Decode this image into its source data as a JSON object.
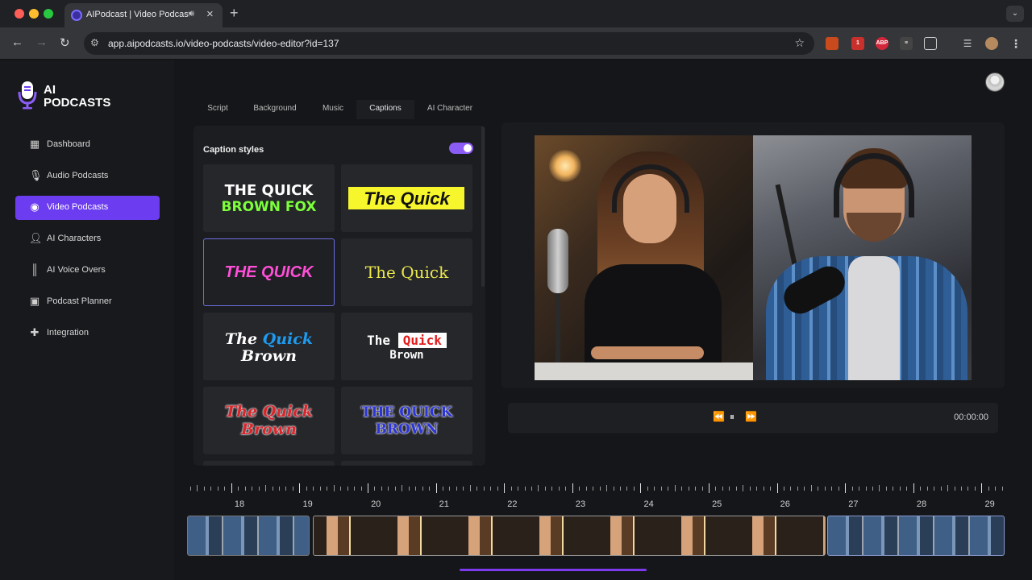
{
  "browser": {
    "tab_title": "AIPodcast | Video Podcasts",
    "audio_icon": "speaker-icon",
    "url": "app.aipodcasts.io/video-podcasts/video-editor?id=137",
    "new_tab": "+",
    "close": "×",
    "extension_abp": "ABP",
    "extension_badge": "1"
  },
  "sidebar": {
    "logo_line1": "AI",
    "logo_line2": "PODCASTS",
    "items": [
      {
        "label": "Dashboard",
        "icon": "grid-icon"
      },
      {
        "label": "Audio Podcasts",
        "icon": "microphone-icon"
      },
      {
        "label": "Video Podcasts",
        "icon": "podcast-icon",
        "active": true
      },
      {
        "label": "AI Characters",
        "icon": "user-icon"
      },
      {
        "label": "AI Voice Overs",
        "icon": "waveform-icon"
      },
      {
        "label": "Podcast Planner",
        "icon": "calendar-icon"
      },
      {
        "label": "Integration",
        "icon": "puzzle-icon"
      }
    ]
  },
  "editor": {
    "tabs": [
      "Script",
      "Background",
      "Music",
      "Captions",
      "AI Character"
    ],
    "active_tab": "Captions",
    "panel_title": "Caption styles",
    "toggle_on": true,
    "captions": [
      {
        "line1": "THE QUICK",
        "line2": "BROWN FOX"
      },
      {
        "line1": "The Quick"
      },
      {
        "line1": "THE QUICK",
        "selected": true
      },
      {
        "line1": "The Quick"
      },
      {
        "line1": "The",
        "line1b": "Quick",
        "line2": "Brown"
      },
      {
        "line1": "The",
        "line1b": "Quick",
        "line2": "Brown"
      },
      {
        "line1": "The Quick",
        "line2": "Brown"
      },
      {
        "line1": "THE QUICK",
        "line2": "BROWN"
      }
    ]
  },
  "player": {
    "rewind": "⏪",
    "pause": "⏸",
    "forward": "⏩",
    "timecode": "00:00:00"
  },
  "timeline": {
    "labels": [
      "18",
      "19",
      "20",
      "21",
      "22",
      "23",
      "24",
      "25",
      "26",
      "27",
      "28",
      "29"
    ]
  },
  "colors": {
    "accent": "#6c3cf0",
    "toggle": "#8b5cf6",
    "scroll_indicator": "#7c3aed"
  }
}
